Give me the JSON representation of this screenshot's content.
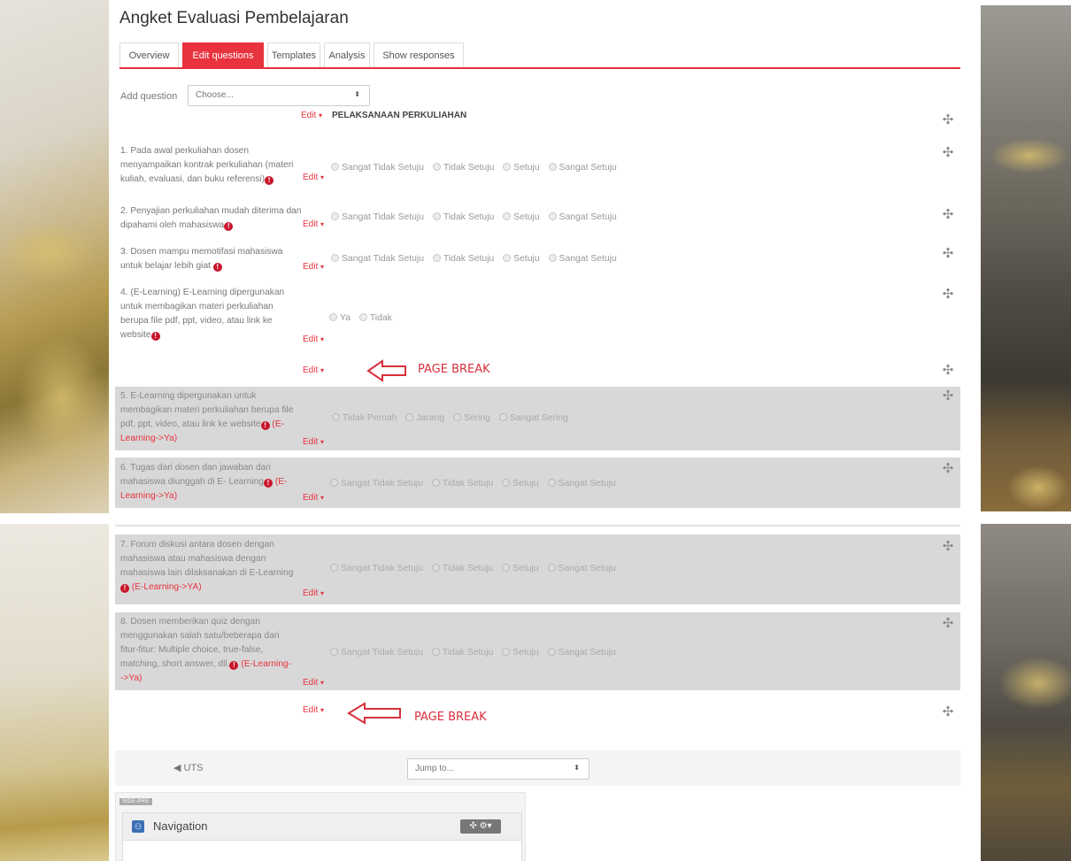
{
  "page": {
    "title": "Angket Evaluasi Pembelajaran"
  },
  "tabs": [
    {
      "label": "Overview",
      "active": false
    },
    {
      "label": "Edit questions",
      "active": true
    },
    {
      "label": "Templates",
      "active": false
    },
    {
      "label": "Analysis",
      "active": false
    },
    {
      "label": "Show responses",
      "active": false
    }
  ],
  "add_question": {
    "label": "Add question",
    "selected": "Choose..."
  },
  "edit_menu": {
    "label": "Edit",
    "caret": "▾"
  },
  "section": {
    "heading": "PELAKSANAAN PERKULIAHAN",
    "caret": "▾"
  },
  "likert_options": [
    "Sangat Tidak Setuju",
    "Tidak Setuju",
    "Setuju",
    "Sangat Setuju"
  ],
  "questions": [
    {
      "lines": [
        "1. Pada awal perkuliahan dosen",
        "menyampaikan kontrak perkuliahan (materi",
        "kuliah, evaluasi, dan buku referensi)"
      ]
    },
    {
      "lines": [
        "2. Penyajian perkuliahan mudah diterima dan",
        "dipahami oleh mahasiswa"
      ]
    },
    {
      "lines": [
        "3. Dosen mampu memotifasi mahasiswa",
        "untuk belajar lebih giat"
      ]
    },
    {
      "lines": [
        "4. (E-Learning) E-Learning dipergunakan",
        "untuk membagikan materi perkuliahan",
        "berupa file pdf, ppt, video, atau link ke",
        "website"
      ],
      "options": [
        "Ya",
        "Tidak"
      ]
    },
    {
      "lines": [
        "5. E-Learning dipergunakan untuk",
        "membagikan materi perkuliahan berupa file",
        "pdf, ppt, video, atau link ke website",
        "Learning->Ya)"
      ],
      "condition_start": "(E-",
      "options": [
        "Tidak Pernah",
        "Jarang",
        "Sering",
        "Sangat Sering"
      ]
    },
    {
      "lines": [
        "6. Tugas dari dosen dan jawaban dari",
        "mahasiswa diunggah di E- Learning",
        "Learning->Ya)"
      ],
      "condition_start": "(E-"
    },
    {
      "lines": [
        "7. Forum diskusi antara dosen dengan",
        "mahasiswa atau mahasiswa dengan",
        "mahasiswa lain dilaksanakan di E-Learning"
      ],
      "condition": "(E-Learning->YA)"
    },
    {
      "lines": [
        "8. Dosen memberikan quiz dengan",
        "menggunakan salah satu/beberapa dari",
        "fitur-fitur: Multiple choice, true-false,",
        "matching, short answer, dll.",
        "->Ya)"
      ],
      "condition_start": "(E-Learning-"
    }
  ],
  "page_break": {
    "label": "PAGE BREAK"
  },
  "flag_glyph": "!",
  "bottom_nav": {
    "prev_label": "◀ UTS",
    "jump_placeholder": "Jump to..."
  },
  "side_pre": {
    "label": "SIDE-PRE"
  },
  "navigation_block": {
    "title": "Navigation",
    "controls": "✣ ⚙▾"
  },
  "colors": {
    "accent": "#e8323d",
    "grey_block": "#d8d8d8"
  }
}
